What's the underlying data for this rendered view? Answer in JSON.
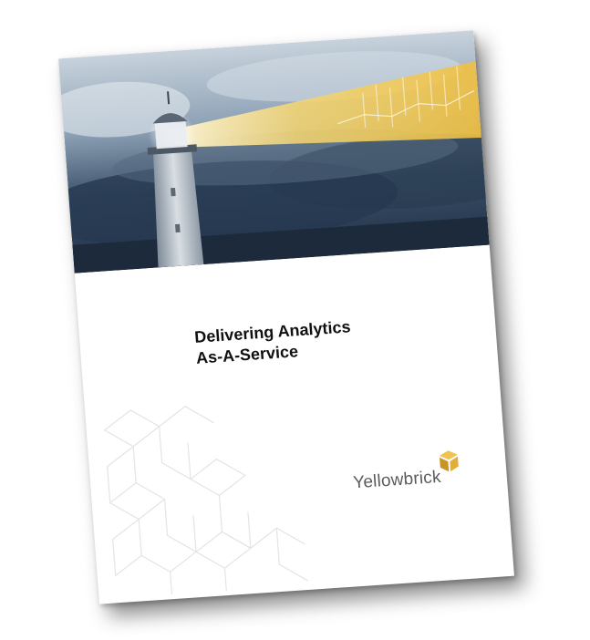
{
  "document": {
    "title_line1": "Delivering Analytics",
    "title_line2": "As-A-Service",
    "brand": "Yellowbrick"
  },
  "colors": {
    "sky_dark": "#2c4058",
    "sky_light": "#b9c6d3",
    "beam": "#f3c94d",
    "logo_gold": "#d8a73a",
    "logo_text": "#5b5b5b"
  }
}
